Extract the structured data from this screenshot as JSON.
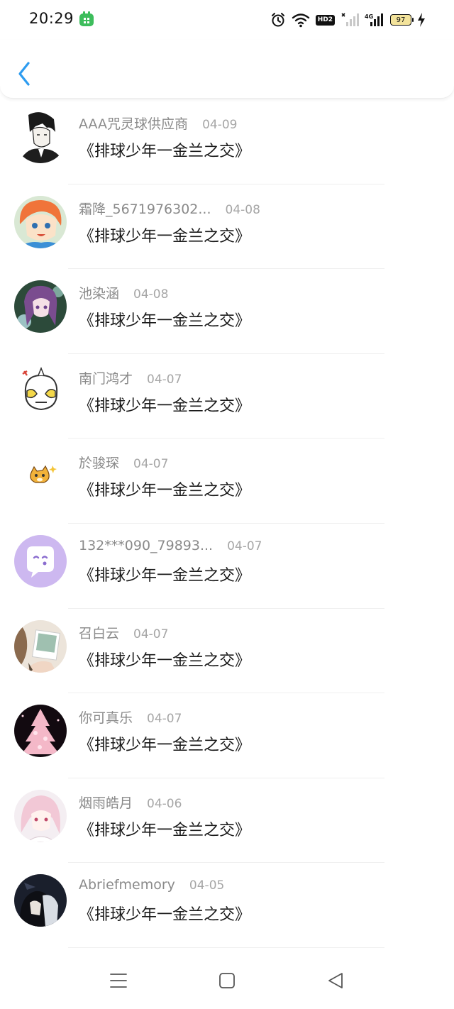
{
  "status_bar": {
    "time": "20:29",
    "battery_level": "97",
    "network_badge": "HD2",
    "network_type": "4G",
    "icons": [
      "app-notification-icon",
      "alarm-icon",
      "wifi-icon",
      "hd-icon",
      "signal-icon-1",
      "signal-icon-2",
      "battery-icon",
      "charging-icon"
    ]
  },
  "header": {
    "back_icon": "chevron-left-icon",
    "accent_color": "#2d9cf0"
  },
  "items": [
    {
      "name": "AAA咒灵球供应商",
      "date": "04-09",
      "title": "《排球少年一金兰之交》"
    },
    {
      "name": "霜降_5671976302...",
      "date": "04-08",
      "title": "《排球少年一金兰之交》"
    },
    {
      "name": "池染涵",
      "date": "04-08",
      "title": "《排球少年一金兰之交》"
    },
    {
      "name": "南门鸿才",
      "date": "04-07",
      "title": "《排球少年一金兰之交》"
    },
    {
      "name": "於骏琛",
      "date": "04-07",
      "title": "《排球少年一金兰之交》"
    },
    {
      "name": "132***090_79893...",
      "date": "04-07",
      "title": "《排球少年一金兰之交》"
    },
    {
      "name": "召白云",
      "date": "04-07",
      "title": "《排球少年一金兰之交》"
    },
    {
      "name": "你可真乐",
      "date": "04-07",
      "title": "《排球少年一金兰之交》"
    },
    {
      "name": "烟雨皓月",
      "date": "04-06",
      "title": "《排球少年一金兰之交》"
    },
    {
      "name": "Abriefmemory",
      "date": "04-05",
      "title": "《排球少年一金兰之交》"
    }
  ],
  "nav_bar": {
    "icons": [
      "menu-icon",
      "home-square-icon",
      "back-triangle-icon"
    ]
  }
}
